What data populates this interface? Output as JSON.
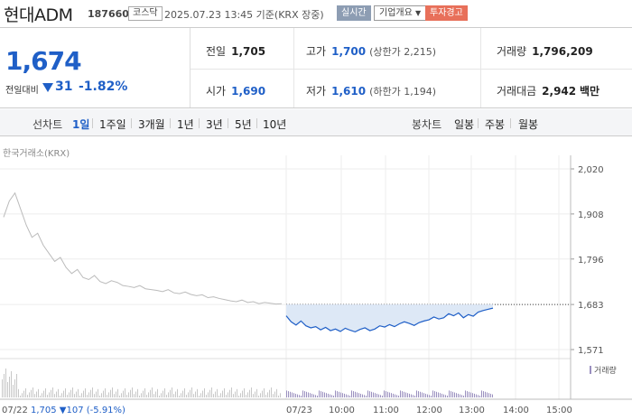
{
  "header": {
    "name": "현대ADM",
    "code": "187660",
    "market": "코스닥",
    "time": "2025.07.23 13:45 기준(KRX 장중)",
    "realtime_btn": "실시간",
    "company_btn": "기업개요",
    "warning_btn": "투자경고"
  },
  "quote": {
    "price": "1,674",
    "change_label": "전일대비",
    "change": "31",
    "change_pct": "-1.82%",
    "prev_close_label": "전일",
    "prev_close": "1,705",
    "high_label": "고가",
    "high": "1,700",
    "high_limit": "(상한가 2,215)",
    "volume_label": "거래량",
    "volume": "1,796,209",
    "open_label": "시가",
    "open": "1,690",
    "low_label": "저가",
    "low": "1,610",
    "low_limit": "(하한가 1,194)",
    "amount_label": "거래대금",
    "amount": "2,942",
    "amount_unit": "백만"
  },
  "tabs": {
    "line_label": "선차트",
    "line": [
      "1일",
      "1주일",
      "3개월",
      "1년",
      "3년",
      "5년",
      "10년"
    ],
    "candle_label": "봉차트",
    "candle": [
      "일봉",
      "주봉",
      "월봉"
    ]
  },
  "colors": {
    "blue": "#1f5fc7",
    "fill": "#dde8f6",
    "gray_line": "#bbbbbb",
    "warning": "#e8705a"
  },
  "chart_data": {
    "type": "line",
    "source_label": "한국거래소(KRX)",
    "yticks": [
      "2,020",
      "1,908",
      "1,796",
      "1,683",
      "1,571"
    ],
    "ylim": [
      1571,
      2020
    ],
    "prev_close": 1683,
    "xticks": [
      "07/23",
      "10:00",
      "11:00",
      "12:00",
      "13:00",
      "14:00",
      "15:00"
    ],
    "prev_day_label": "07/22",
    "prev_day_info": "1,705 ▼107 (-5.91%)",
    "volume_legend": "거래량",
    "series": [
      {
        "values": [
          1900,
          1940,
          1960,
          1920,
          1880,
          1850,
          1860,
          1830,
          1810,
          1790,
          1800,
          1775,
          1760,
          1770,
          1750,
          1745,
          1755,
          1740,
          1735,
          1742,
          1738,
          1730,
          1728,
          1725,
          1730,
          1722,
          1720,
          1718,
          1715,
          1720,
          1712,
          1710,
          1714,
          1708,
          1705,
          1707,
          1700,
          1702,
          1698,
          1695,
          1692,
          1690,
          1694,
          1688,
          1690,
          1685,
          1688,
          1686,
          1684,
          1685
        ]
      },
      {
        "values": [
          1655,
          1640,
          1632,
          1642,
          1630,
          1625,
          1628,
          1620,
          1626,
          1618,
          1622,
          1616,
          1624,
          1619,
          1615,
          1621,
          1625,
          1618,
          1622,
          1630,
          1627,
          1633,
          1628,
          1635,
          1640,
          1636,
          1631,
          1638,
          1642,
          1645,
          1652,
          1647,
          1650,
          1660,
          1655,
          1662,
          1650,
          1658,
          1654,
          1664,
          1668,
          1671,
          1674
        ]
      }
    ]
  }
}
